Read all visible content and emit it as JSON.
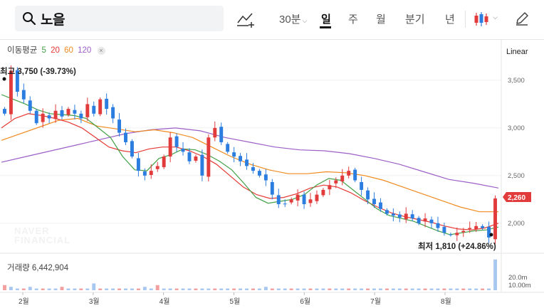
{
  "search": {
    "query": "노을"
  },
  "periods": [
    {
      "label": "30분",
      "active": false
    },
    {
      "label": "일",
      "active": true
    },
    {
      "label": "주",
      "active": false
    },
    {
      "label": "월",
      "active": false
    },
    {
      "label": "분기",
      "active": false
    },
    {
      "label": "년",
      "active": false
    }
  ],
  "icons": {
    "search": "search-icon",
    "indicator": "indicator-add-icon",
    "chart_type": "candlestick-icon",
    "draw": "pencil-icon"
  },
  "ma_legend": {
    "label": "이동평균",
    "periods": [
      {
        "value": "5",
        "color": "#43a047"
      },
      {
        "value": "20",
        "color": "#e53935"
      },
      {
        "value": "60",
        "color": "#ef8a1e"
      },
      {
        "value": "120",
        "color": "#9c5fc7"
      }
    ],
    "close": "×"
  },
  "scale": "Linear",
  "annotations": {
    "high": "최고 3,750 (-39.73%)",
    "low": "최저 1,810 (+24.86%)"
  },
  "current_price": "2,260",
  "volume_legend": "거래량 6,442,904",
  "volume_axis": [
    "20.0m",
    "10.00m"
  ],
  "watermark": [
    "NAVER",
    "FINANCIAL"
  ],
  "chart_data": {
    "type": "candlestick",
    "x": [
      "2월",
      "3월",
      "4월",
      "5월",
      "6월",
      "7월",
      "8월"
    ],
    "y_ticks": [
      "3,500",
      "3,000",
      "2,500",
      "2,000"
    ],
    "ylim": [
      1700,
      3850
    ],
    "high": {
      "value": 3750
    },
    "low": {
      "value": 1810
    },
    "last": 2260,
    "colors": {
      "up": "#e23b3b",
      "down": "#2b7de0",
      "ma5": "#43a047",
      "ma20": "#e53935",
      "ma60": "#ef8a1e",
      "ma120": "#9c5fc7"
    },
    "closes": [
      3150,
      3600,
      3380,
      3300,
      3180,
      3050,
      3150,
      3100,
      3180,
      3120,
      3200,
      3150,
      3100,
      3250,
      3150,
      3300,
      3200,
      3100,
      2950,
      2850,
      2700,
      2550,
      2500,
      2550,
      2600,
      2700,
      2900,
      2800,
      2750,
      2650,
      2700,
      2500,
      2900,
      3000,
      2850,
      2750,
      2700,
      2650,
      2600,
      2550,
      2500,
      2450,
      2300,
      2200,
      2200,
      2250,
      2300,
      2200,
      2250,
      2300,
      2350,
      2400,
      2450,
      2500,
      2550,
      2450,
      2350,
      2250,
      2200,
      2150,
      2100,
      2080,
      2060,
      2100,
      2050,
      2000,
      2050,
      2000,
      1950,
      1900,
      1880,
      1900,
      1920,
      1950,
      1970,
      1950,
      1850,
      2260
    ],
    "ma5": [
      3350,
      3300,
      3250,
      3190,
      3150,
      3140,
      3130,
      3100,
      3000,
      2900,
      2700,
      2560,
      2550,
      2680,
      2720,
      2780,
      2770,
      2720,
      2650,
      2560,
      2420,
      2270,
      2210,
      2230,
      2250,
      2300,
      2400,
      2470,
      2450,
      2350,
      2250,
      2150,
      2080,
      2050,
      2020,
      1970,
      1920,
      1880,
      1900,
      1920,
      1930,
      1960
    ],
    "ma20": [
      3000,
      3100,
      3150,
      3130,
      3100,
      3060,
      3000,
      2900,
      2800,
      2760,
      2740,
      2780,
      2800,
      2800,
      2760,
      2700,
      2620,
      2500,
      2380,
      2300,
      2260,
      2270,
      2310,
      2370,
      2400,
      2380,
      2320,
      2240,
      2170,
      2110,
      2070,
      2040,
      2010,
      1970,
      1940,
      1930,
      1950,
      2000
    ],
    "ma60": [
      2870,
      2940,
      3010,
      3080,
      3100,
      3020,
      2990,
      2960,
      2980,
      2950,
      2900,
      2800,
      2700,
      2620,
      2560,
      2520,
      2520,
      2540,
      2530,
      2500,
      2450,
      2380,
      2310,
      2240,
      2170,
      2120,
      2120
    ],
    "ma120": [
      2640,
      2700,
      2760,
      2820,
      2880,
      2940,
      2980,
      3000,
      2970,
      2900,
      2850,
      2800,
      2770,
      2760,
      2730,
      2680,
      2620,
      2540,
      2460,
      2420,
      2370
    ],
    "volume_scale_max": 25,
    "volumes": [
      3,
      2,
      1,
      1,
      2,
      1,
      1,
      1,
      1,
      2,
      1,
      1,
      1,
      1,
      4,
      1,
      1,
      1,
      1,
      1,
      1,
      1,
      2,
      1,
      3,
      1,
      1,
      1,
      1,
      1,
      1,
      1,
      1,
      1,
      1,
      1,
      1,
      1,
      1,
      1,
      1,
      2,
      1,
      1,
      1,
      1,
      1,
      1,
      1,
      1,
      1,
      1,
      1,
      1,
      1,
      1,
      1,
      1,
      1,
      1,
      1,
      1,
      1,
      1,
      1,
      1,
      1,
      1,
      1,
      1,
      1,
      1,
      1,
      1,
      1,
      1,
      1,
      18
    ]
  }
}
